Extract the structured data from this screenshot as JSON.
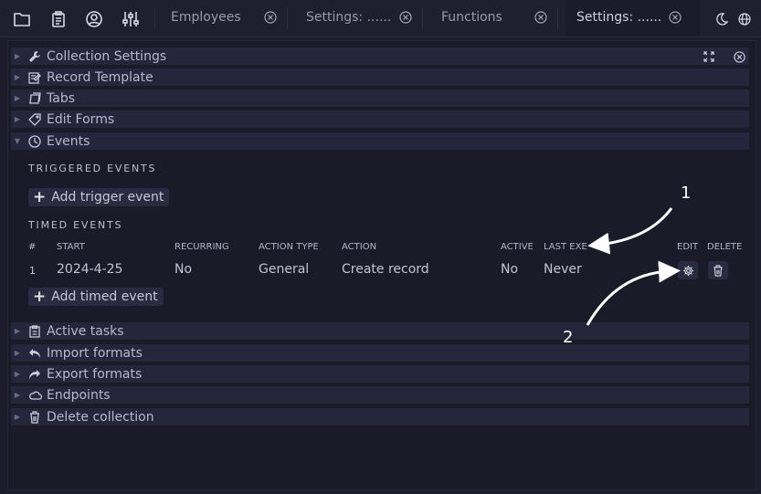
{
  "toolbar": {
    "icons": [
      "folder-icon",
      "clipboard-icon",
      "user-circle-icon",
      "sliders-icon"
    ]
  },
  "tabs": [
    {
      "label": "Employees",
      "active": false
    },
    {
      "label": "Settings: ......",
      "active": false
    },
    {
      "label": "Functions",
      "active": false
    },
    {
      "label": "Settings: ......",
      "active": true
    }
  ],
  "sections_top": [
    {
      "label": "Collection Settings",
      "icon": "wrench-icon"
    },
    {
      "label": "Record Template",
      "icon": "edit-icon"
    },
    {
      "label": "Tabs",
      "icon": "tabs-icon"
    },
    {
      "label": "Edit Forms",
      "icon": "tag-icon"
    },
    {
      "label": "Events",
      "icon": "clock-icon",
      "expanded": true
    }
  ],
  "events": {
    "triggered_title": "TRIGGERED EVENTS",
    "add_trigger": "Add trigger event",
    "timed_title": "TIMED EVENTS",
    "columns": [
      "#",
      "START",
      "RECURRING",
      "ACTION TYPE",
      "ACTION",
      "ACTIVE",
      "LAST EXE",
      "EDIT",
      "DELETE"
    ],
    "rows": [
      {
        "num": "1",
        "start": "2024-4-25",
        "recurring": "No",
        "action_type": "General",
        "action": "Create record",
        "active": "No",
        "last_exe": "Never"
      }
    ],
    "add_timed": "Add timed event"
  },
  "sections_bottom": [
    {
      "label": "Active tasks",
      "icon": "clipboard-icon"
    },
    {
      "label": "Import formats",
      "icon": "undo-icon"
    },
    {
      "label": "Export formats",
      "icon": "redo-icon"
    },
    {
      "label": "Endpoints",
      "icon": "cloud-icon"
    },
    {
      "label": "Delete collection",
      "icon": "trash-icon"
    }
  ],
  "annotations": [
    "1",
    "2"
  ]
}
